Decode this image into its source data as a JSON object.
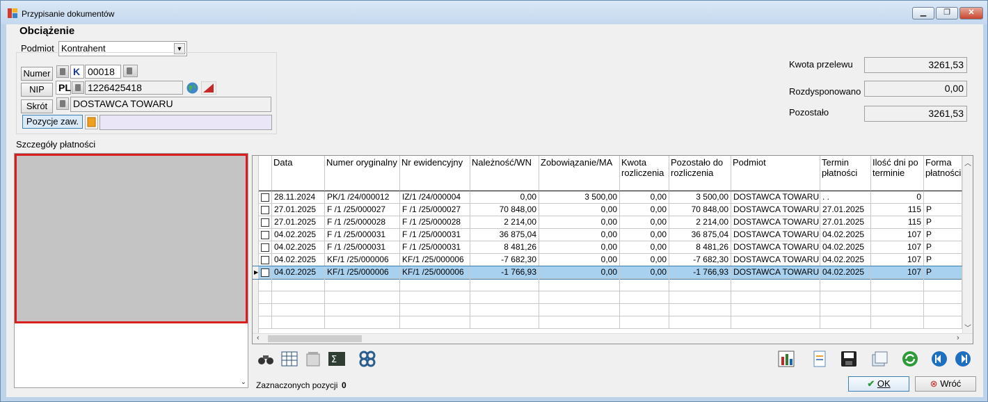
{
  "window": {
    "title": "Przypisanie dokumentów",
    "minimize": "▁",
    "maximize": "❐",
    "close": "✕"
  },
  "header": {
    "title": "Obciążenie"
  },
  "podmiot": {
    "label": "Podmiot",
    "value": "Kontrahent"
  },
  "contractor": {
    "numer_button": "Numer",
    "numer_type": "K",
    "numer_value": "00018",
    "nip_button": "NIP",
    "nip_prefix": "PL",
    "nip_value": "1226425418",
    "skrot_button": "Skrót",
    "skrot_value": "DOSTAWCA TOWARU",
    "pozycje_button": "Pozycje zaw.",
    "pozycje_value": ""
  },
  "totals": {
    "kwota_label": "Kwota przelewu",
    "kwota_value": "3261,53",
    "rozdysp_label": "Rozdysponowano",
    "rozdysp_value": "0,00",
    "pozostalo_label": "Pozostało",
    "pozostalo_value": "3261,53"
  },
  "details_label": "Szczegóły płatności",
  "grid": {
    "headers": [
      "Data",
      "Numer oryginalny",
      "Nr ewidencyjny",
      "Należność/WN",
      "Zobowiązanie/MA",
      "Kwota rozliczenia",
      "Pozostało do rozliczenia",
      "Podmiot",
      "Termin płatności",
      "Ilość dni po terminie",
      "Forma płatności"
    ],
    "rows": [
      [
        "28.11.2024",
        "PK/1 /24/000012",
        "IZ/1 /24/000004",
        "0,00",
        "3 500,00",
        "0,00",
        "3 500,00",
        "DOSTAWCA TOWARU",
        ". .",
        "0",
        ""
      ],
      [
        "27.01.2025",
        "F /1 /25/000027",
        "F /1 /25/000027",
        "70 848,00",
        "0,00",
        "0,00",
        "70 848,00",
        "DOSTAWCA TOWARU",
        "27.01.2025",
        "115",
        "P"
      ],
      [
        "27.01.2025",
        "F /1 /25/000028",
        "F /1 /25/000028",
        "2 214,00",
        "0,00",
        "0,00",
        "2 214,00",
        "DOSTAWCA TOWARU",
        "27.01.2025",
        "115",
        "P"
      ],
      [
        "04.02.2025",
        "F /1 /25/000031",
        "F /1 /25/000031",
        "36 875,04",
        "0,00",
        "0,00",
        "36 875,04",
        "DOSTAWCA TOWARU",
        "04.02.2025",
        "107",
        "P"
      ],
      [
        "04.02.2025",
        "F /1 /25/000031",
        "F /1 /25/000031",
        "8 481,26",
        "0,00",
        "0,00",
        "8 481,26",
        "DOSTAWCA TOWARU",
        "04.02.2025",
        "107",
        "P"
      ],
      [
        "04.02.2025",
        "KF/1 /25/000006",
        "KF/1 /25/000006",
        "-7 682,30",
        "0,00",
        "0,00",
        "-7 682,30",
        "DOSTAWCA TOWARU",
        "04.02.2025",
        "107",
        "P"
      ],
      [
        "04.02.2025",
        "KF/1 /25/000006",
        "KF/1 /25/000006",
        "-1 766,93",
        "0,00",
        "0,00",
        "-1 766,93",
        "DOSTAWCA TOWARU",
        "04.02.2025",
        "107",
        "P"
      ]
    ]
  },
  "footer": {
    "selected_label": "Zaznaczonych pozycji",
    "selected_count": "0",
    "ok": "OK",
    "back": "Wróć"
  },
  "icons": [
    "binoculars-icon",
    "table-icon",
    "recycle-bin-icon",
    "sum-icon",
    "gears-icon",
    "chart-icon",
    "document-icon",
    "save-icon",
    "copy-icon",
    "refresh-icon",
    "previous-icon",
    "next-icon"
  ]
}
